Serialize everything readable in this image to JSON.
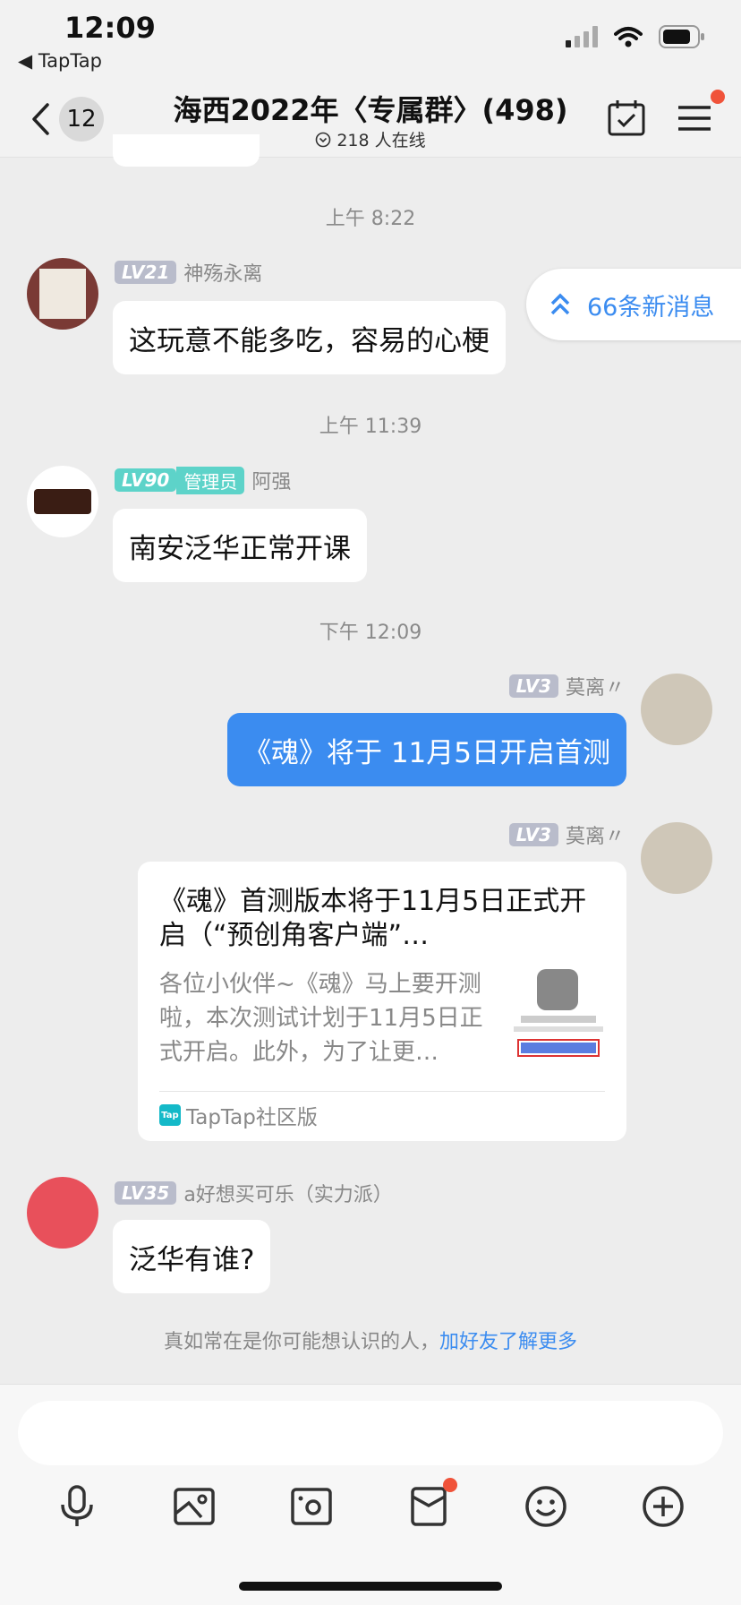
{
  "status_bar": {
    "time": "12:09",
    "back_app": "◀ TapTap"
  },
  "header": {
    "back_count": "12",
    "title": "海西2022年〈专属群〉(498)",
    "online": "218 人在线"
  },
  "new_messages": "66条新消息",
  "messages": [
    {
      "time": "上午 8:22",
      "level": "LV21",
      "name": "神殇永离",
      "text": "这玩意不能多吃，容易的心梗"
    },
    {
      "time": "上午 11:39",
      "level": "LV90",
      "role": "管理员",
      "name": "阿强",
      "text": "南安泛华正常开课"
    },
    {
      "time": "下午 12:09",
      "level": "LV3",
      "name": "莫离〃",
      "text": "《魂》将于 11月5日开启首测"
    },
    {
      "level": "LV3",
      "name": "莫离〃",
      "card": {
        "title": "《魂》首测版本将于11月5日正式开启（“预创角客户端”…",
        "desc": "各位小伙伴~《魂》马上要开测啦，本次测试计划于11月5日正式开启。此外，为了让更…",
        "source": "TapTap社区版",
        "logo": "Tap"
      }
    },
    {
      "level": "LV35",
      "name": "a好想买可乐（实力派）",
      "text": "泛华有谁?"
    }
  ],
  "suggestion": {
    "text": "真如常在是你可能想认识的人，",
    "link": "加好友了解更多"
  },
  "toolbar": [
    "mic-icon",
    "image-icon",
    "camera-icon",
    "redpacket-icon",
    "emoji-icon",
    "plus-icon"
  ],
  "colors": {
    "accent": "#3b8cf0",
    "admin": "#5dd3c9",
    "badge_red": "#f0533a"
  }
}
